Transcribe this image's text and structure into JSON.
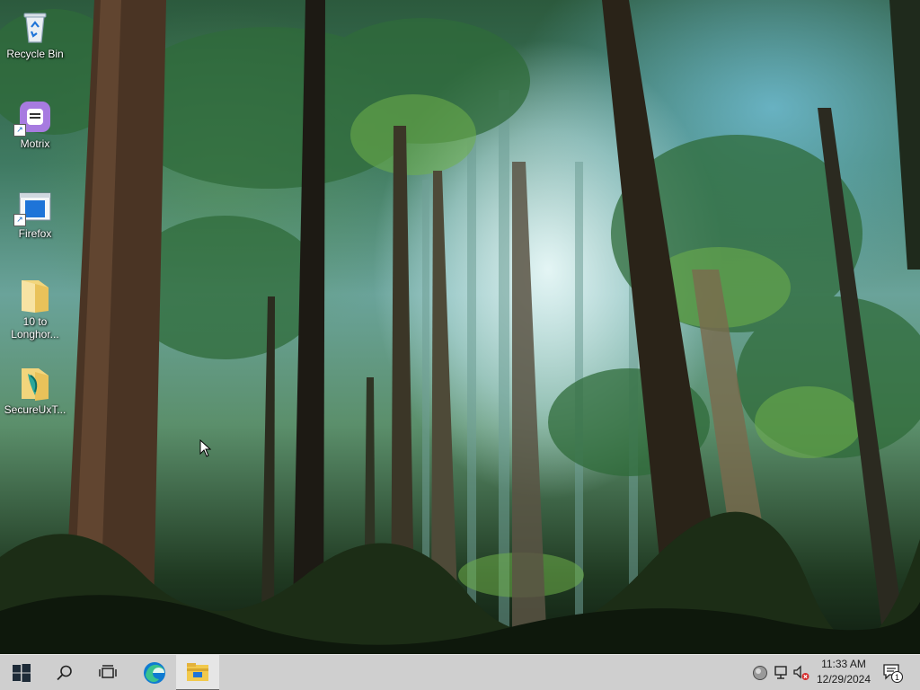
{
  "desktop": {
    "icons": [
      {
        "label": "Recycle Bin",
        "icon": "recycle-bin-icon"
      },
      {
        "label": "Motrix",
        "icon": "motrix-icon"
      },
      {
        "label": "Firefox",
        "icon": "firefox-shortcut-icon"
      },
      {
        "label": "10 to\nLonghor...",
        "icon": "folder-icon"
      },
      {
        "label": "SecureUxT...",
        "icon": "secureux-folder-icon"
      }
    ]
  },
  "taskbar": {
    "buttons": [
      {
        "name": "start",
        "icon": "windows-logo-icon"
      },
      {
        "name": "search",
        "icon": "search-icon"
      },
      {
        "name": "task-view",
        "icon": "task-view-icon"
      },
      {
        "name": "edge",
        "icon": "edge-icon"
      },
      {
        "name": "file-explorer",
        "icon": "file-explorer-icon",
        "active": true
      }
    ],
    "tray": {
      "icons": [
        "network-globe-icon",
        "network-monitor-icon",
        "volume-muted-icon"
      ],
      "time": "11:33 AM",
      "date": "12/29/2024",
      "notification_count": "1"
    }
  },
  "colors": {
    "taskbar_bg": "#cfcfcf",
    "accent_blue": "#1e74d8",
    "folder_yellow": "#f2c94c"
  }
}
